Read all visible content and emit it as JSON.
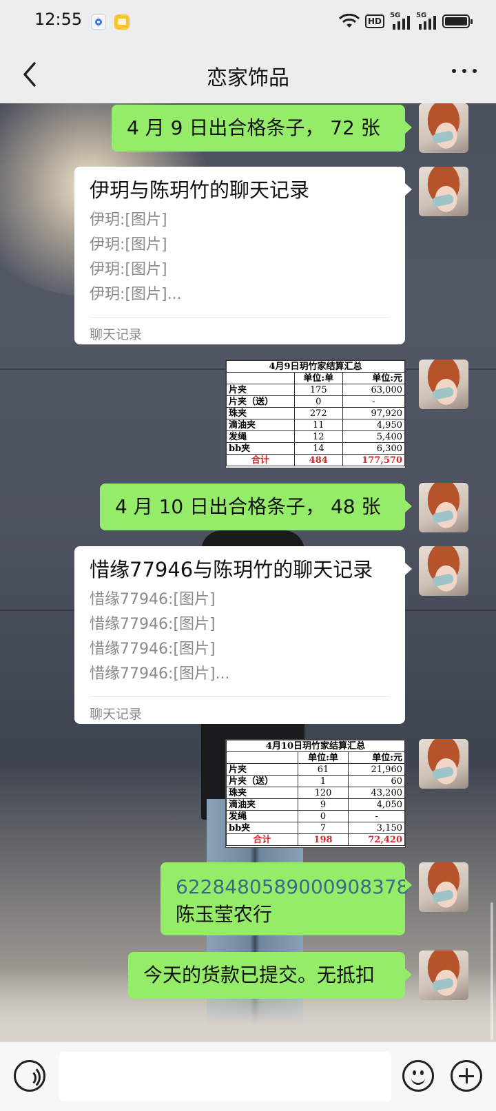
{
  "status_bar": {
    "time": "12:55",
    "network": "5G",
    "hd": "HD"
  },
  "header": {
    "title": "恋家饰品",
    "back_icon": "chevron-left-icon",
    "more_icon": "more-dots-icon"
  },
  "messages": [
    {
      "type": "text",
      "side": "self",
      "text": "4 月 9 日出合格条子， 72 张"
    },
    {
      "type": "record",
      "side": "self",
      "title": "伊玥与陈玥竹的聊天记录",
      "lines": [
        "伊玥:[图片]",
        "伊玥:[图片]",
        "伊玥:[图片]",
        "伊玥:[图片]..."
      ],
      "footer": "聊天记录"
    },
    {
      "type": "image_table",
      "side": "self",
      "title": "4月9日玥竹家结算汇总",
      "headers": [
        "",
        "单位:单",
        "单位:元"
      ],
      "rows": [
        [
          "片夹",
          "175",
          "63,000"
        ],
        [
          "片夹（送）",
          "0",
          "-"
        ],
        [
          "珠夹",
          "272",
          "97,920"
        ],
        [
          "滴油夹",
          "11",
          "4,950"
        ],
        [
          "发绳",
          "12",
          "5,400"
        ],
        [
          "bb夹",
          "14",
          "6,300"
        ]
      ],
      "total": [
        "合计",
        "484",
        "177,570"
      ]
    },
    {
      "type": "text",
      "side": "self",
      "text": "4 月 10 日出合格条子， 48 张"
    },
    {
      "type": "record",
      "side": "self",
      "title": "惜缘77946与陈玥竹的聊天记录",
      "lines": [
        "惜缘77946:[图片]",
        "惜缘77946:[图片]",
        "惜缘77946:[图片]",
        "惜缘77946:[图片]..."
      ],
      "footer": "聊天记录"
    },
    {
      "type": "image_table",
      "side": "self",
      "title": "4月10日玥竹家结算汇总",
      "headers": [
        "",
        "单位:单",
        "单位:元"
      ],
      "rows": [
        [
          "片夹",
          "61",
          "21,960"
        ],
        [
          "片夹（送）",
          "1",
          "60"
        ],
        [
          "珠夹",
          "120",
          "43,200"
        ],
        [
          "滴油夹",
          "9",
          "4,050"
        ],
        [
          "发绳",
          "0",
          "-"
        ],
        [
          "bb夹",
          "7",
          "3,150"
        ]
      ],
      "total": [
        "合计",
        "198",
        "72,420"
      ]
    },
    {
      "type": "text_link",
      "side": "self",
      "link": "6228480589000908378",
      "text": "陈玉莹农行",
      "link_color": "#3a6b88"
    },
    {
      "type": "text",
      "side": "self",
      "text": "今天的货款已提交。无抵扣"
    }
  ],
  "input_bar": {
    "voice_icon": "voice-icon",
    "emoji_icon": "emoji-icon",
    "plus_icon": "plus-icon"
  },
  "colors": {
    "bubble_green": "#95ec69",
    "bubble_white": "#ffffff",
    "bar_bg": "#ededed",
    "total_red": "#d42828"
  }
}
